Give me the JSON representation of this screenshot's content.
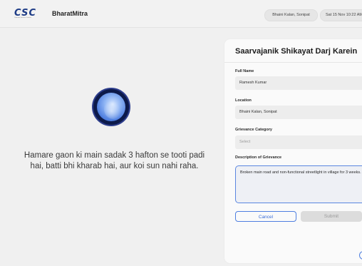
{
  "header": {
    "logo_text": "CSC",
    "logo_subtext": "Common Services Centres",
    "app_name": "BharatMitra",
    "location_pill": "Bhaini Kalan, Sonipat",
    "datetime_pill": "Sat 15 Nov  10:22 AM"
  },
  "assistant": {
    "orb_icon": "voice-orb-icon",
    "transcript": "Hamare gaon ki main sadak 3 hafton se tooti padi hai, batti bhi kharab hai, aur koi sun nahi raha."
  },
  "form": {
    "title": "Saarvajanik Shikayat Darj Karein",
    "full_name": {
      "label": "Full Name",
      "value": "Ramesh Kumar"
    },
    "location": {
      "label": "Location",
      "value": "Bhaini Kalan, Sonipat"
    },
    "category": {
      "label": "Grievance Category",
      "placeholder": "Select"
    },
    "description": {
      "label": "Description of Grievance",
      "value": "Broken main road and non-functional streetlight in village for 3 weeks."
    },
    "cancel_label": "Cancel",
    "submit_label": "Submit"
  },
  "colors": {
    "accent": "#4f7fe0",
    "brand": "#1d3b86",
    "background": "#f0f0f0"
  }
}
